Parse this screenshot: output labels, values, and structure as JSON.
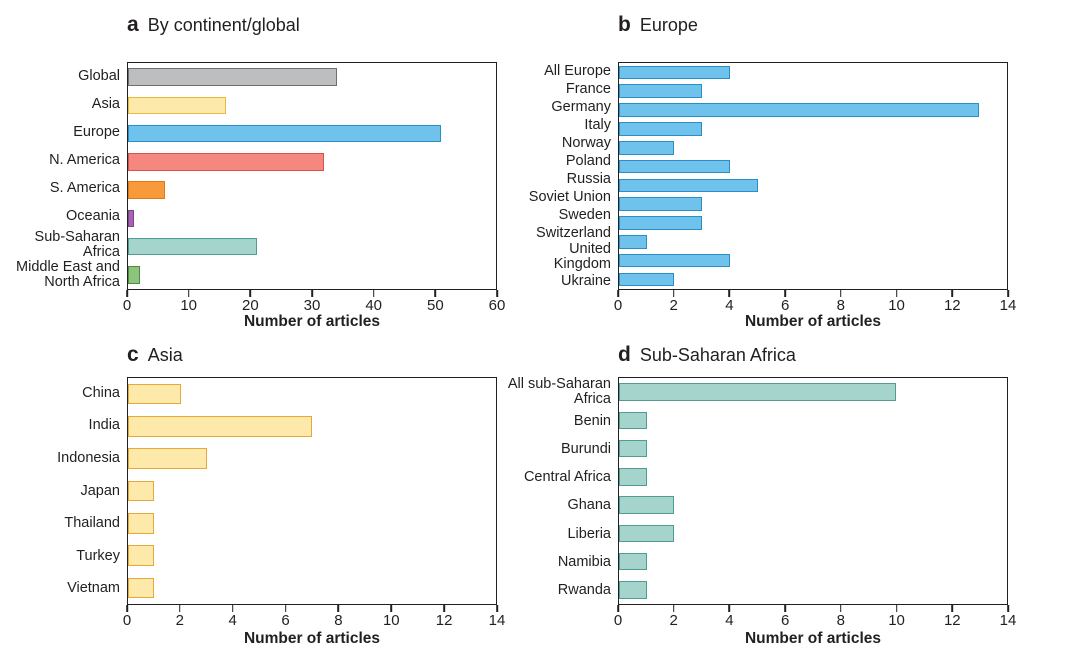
{
  "figure": {
    "axis_title": "Number of articles",
    "panels": [
      {
        "letter": "a",
        "title": "By continent/global"
      },
      {
        "letter": "b",
        "title": "Europe"
      },
      {
        "letter": "c",
        "title": "Asia"
      },
      {
        "letter": "d",
        "title": "Sub-Saharan Africa"
      }
    ]
  },
  "chart_data": [
    {
      "type": "bar",
      "orientation": "horizontal",
      "panel": "a",
      "title": "By continent/global",
      "xlabel": "Number of articles",
      "ylabel": "",
      "xlim": [
        0,
        60
      ],
      "xticks": [
        0,
        10,
        20,
        30,
        40,
        50,
        60
      ],
      "grid": false,
      "legend": "none",
      "categories": [
        "Global",
        "Asia",
        "Europe",
        "N. America",
        "S. America",
        "Oceania",
        "Sub-Saharan\nAfrica",
        "Middle East and\nNorth Africa"
      ],
      "values": [
        34,
        16,
        51,
        32,
        6,
        1,
        21,
        2
      ],
      "colors": [
        "#bcbec0",
        "#fde9a9",
        "#6fc1ea",
        "#f4857c",
        "#f7921e",
        "#a濃"
      ],
      "bar_colors": [
        "#bdbec0",
        "#fde9a9",
        "#6ec2ec",
        "#f4877e",
        "#f89838",
        "#a濃"
      ]
    },
    {
      "type": "bar",
      "orientation": "horizontal",
      "panel": "b",
      "title": "Europe",
      "xlabel": "Number of articles",
      "ylabel": "",
      "xlim": [
        0,
        14
      ],
      "xticks": [
        0,
        2,
        4,
        6,
        8,
        10,
        12,
        14
      ],
      "grid": false,
      "legend": "none",
      "categories": [
        "All Europe",
        "France",
        "Germany",
        "Italy",
        "Norway",
        "Poland",
        "Russia",
        "Soviet Union",
        "Sweden",
        "Switzerland",
        "United Kingdom",
        "Ukraine"
      ],
      "values": [
        4,
        3,
        13,
        3,
        2,
        4,
        5,
        3,
        3,
        1,
        4,
        2
      ]
    },
    {
      "type": "bar",
      "orientation": "horizontal",
      "panel": "c",
      "title": "Asia",
      "xlabel": "Number of articles",
      "ylabel": "",
      "xlim": [
        0,
        14
      ],
      "xticks": [
        0,
        2,
        4,
        6,
        8,
        10,
        12,
        14
      ],
      "grid": false,
      "legend": "none",
      "categories": [
        "China",
        "India",
        "Indonesia",
        "Japan",
        "Thailand",
        "Turkey",
        "Vietnam"
      ],
      "values": [
        2,
        7,
        3,
        1,
        1,
        1,
        1
      ]
    },
    {
      "type": "bar",
      "orientation": "horizontal",
      "panel": "d",
      "title": "Sub-Saharan Africa",
      "xlabel": "Number of articles",
      "ylabel": "",
      "xlim": [
        0,
        14
      ],
      "xticks": [
        0,
        2,
        4,
        6,
        8,
        10,
        12,
        14
      ],
      "grid": false,
      "legend": "none",
      "categories": [
        "All sub-Saharan\nAfrica",
        "Benin",
        "Burundi",
        "Central Africa",
        "Ghana",
        "Liberia",
        "Namibia",
        "Rwanda"
      ],
      "values": [
        10,
        1,
        1,
        1,
        2,
        2,
        1,
        1
      ]
    }
  ],
  "colors": {
    "global_gray": "#bdbec0",
    "asia_yellow": "#fde9a9",
    "europe_blue": "#6ec2ec",
    "n_america_red": "#f4877e",
    "s_america_orange": "#f89a3c",
    "oceania_purple": "#a濃",
    "oceania": "#a563b0",
    "ssa_teal": "#a4d4cb",
    "mena_green": "#8cc47c",
    "axis": "#231f20"
  }
}
